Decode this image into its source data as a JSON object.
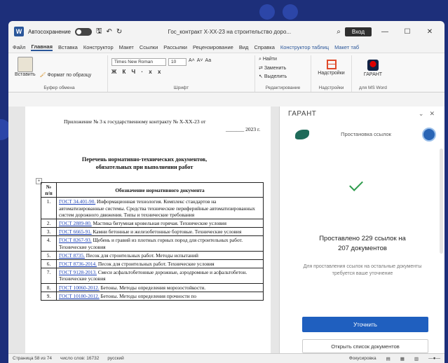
{
  "colors": {
    "accent": "#2b579a",
    "desktop": "#1d2f7a",
    "primary_button": "#1f5fbf",
    "success": "#2e9b4c"
  },
  "titlebar": {
    "autosave_label": "Автосохранение",
    "doc_title": "Гос_контракт Х-ХХ-23 на строительство доро...",
    "signin_label": "Вход",
    "min": "—",
    "max": "☐",
    "close": "✕"
  },
  "tabs": [
    {
      "label": "Файл"
    },
    {
      "label": "Главная"
    },
    {
      "label": "Вставка"
    },
    {
      "label": "Конструктор"
    },
    {
      "label": "Макет"
    },
    {
      "label": "Ссылки"
    },
    {
      "label": "Рассылки"
    },
    {
      "label": "Рецензирование"
    },
    {
      "label": "Вид"
    },
    {
      "label": "Справка"
    },
    {
      "label": "Конструктор таблиц"
    },
    {
      "label": "Макет таб"
    }
  ],
  "ribbon": {
    "clipboard": {
      "paste": "Вставить",
      "format_painter": "Формат по образцу",
      "group": "Буфер обмена"
    },
    "font": {
      "family": "Times New Roman",
      "size": "10",
      "glyphs": "Ж К Ч  ·  x  x",
      "group": "Шрифт"
    },
    "editing": {
      "find": "Найти",
      "replace": "Заменить",
      "select": "Выделить",
      "group": "Редактирование"
    },
    "addins": {
      "label": "Надстройки",
      "group": "Надстройки"
    },
    "garant": {
      "label": "ГАРАНТ",
      "group": "для MS Word"
    }
  },
  "document": {
    "appendix_line": "Приложение № 3 к государственному контракту № Х-ХХ-23 от",
    "appendix_year": "_______ 2023 г.",
    "heading_1": "Перечень нормативно-технических документов,",
    "heading_2": "обязательных при выполнении работ",
    "table_headers": {
      "num": "№ п/п",
      "name": "Обозначение нормативного документа"
    },
    "rows": [
      {
        "num": "1.",
        "code": "ГОСТ 34.401-90.",
        "text": " Информационная технология. Комплекс стандартов на автоматизированные системы. Средства технические периферийные автоматизированных систем дорожного движения. Типы и технические требования"
      },
      {
        "num": "2.",
        "code": "ГОСТ 2889-80.",
        "text": " Мастика битумная кровельная горячая. Технические условия"
      },
      {
        "num": "3.",
        "code": "ГОСТ 6665-91.",
        "text": " Камни бетонные и железобетонные бортовые. Технические условия"
      },
      {
        "num": "4.",
        "code": "ГОСТ 8267-93.",
        "text": " Щебень и гравий из плотных горных пород для строительных работ. Технические условия"
      },
      {
        "num": "5.",
        "code": "ГОСТ 8735.",
        "text": " Песок для строительных работ. Методы испытаний"
      },
      {
        "num": "6.",
        "code": "ГОСТ 8736-2014.",
        "text": " Песок для строительных работ. Технические условия"
      },
      {
        "num": "7.",
        "code": "ГОСТ 9128-2013.",
        "text": " Смеси асфальтобетонные дорожные, аэродромные и асфальтобетон. Технические условия"
      },
      {
        "num": "8.",
        "code": "ГОСТ 10060-2012.",
        "text": " Бетоны. Методы определения морозостойкости."
      },
      {
        "num": "9.",
        "code": "ГОСТ 10180-2012.",
        "text": " Бетоны. Методы определения прочности по"
      }
    ]
  },
  "panel": {
    "title": "ГАРАНТ",
    "section_title": "Простановка ссылок",
    "result_line_1": "Проставлено 229 ссылок на",
    "result_line_2": "207 документов",
    "hint": "Для проставления ссылок на остальные документы требуется ваше уточнение",
    "primary_button": "Уточнить",
    "secondary_button": "Открыть список документов"
  },
  "status": {
    "page": "Страница 58 из 74",
    "words": "число слов: 16732",
    "lang": "русский",
    "focus": "Фокусировка"
  }
}
